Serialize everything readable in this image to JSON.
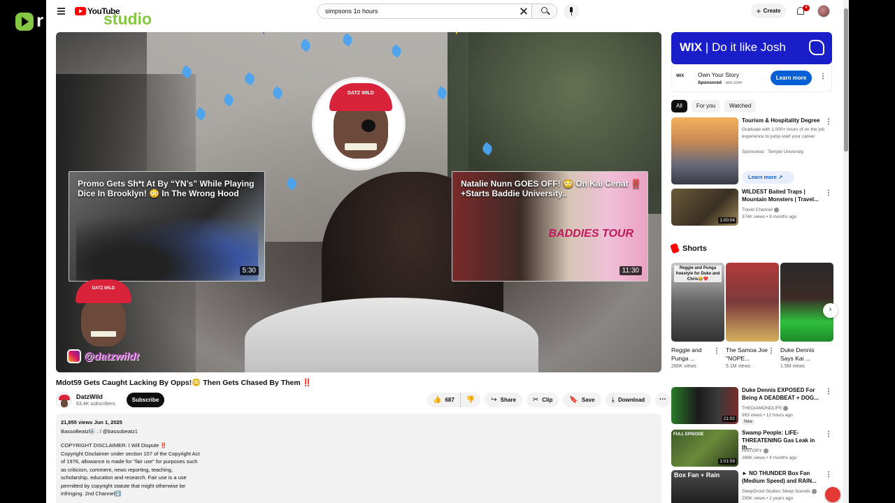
{
  "rumble": {
    "letter": "r"
  },
  "header": {
    "youtube_text": "YouTube",
    "studio_text": "studio",
    "search_value": "simpsons 1o hours",
    "create_label": "Create",
    "notification_count": "4"
  },
  "player": {
    "instagram_handle": "@datzwildt",
    "logo_cap_text": "DATZ WILD",
    "end_cards": [
      {
        "title": "Promo Gets Sh*t At By “YN’s” While Playing Dice In Brooklyn! 😳 In The Wrong Hood",
        "duration": "5:30"
      },
      {
        "title": "Natalie Nunn GOES OFF! 😳 On Kai Cenat ‼️ +Starts Baddie University..",
        "duration": "11:30",
        "overlay_text": "BADDIES TOUR"
      }
    ]
  },
  "video": {
    "title": "Mdot59 Gets Caught Lacking By Opps!😳 Then Gets Chased By Them ‼️",
    "channel_name": "DatzWild",
    "subscribers": "63.4K subscribers",
    "subscribe_label": "Subscribe",
    "likes": "687",
    "share_label": "Share",
    "clip_label": "Clip",
    "save_label": "Save",
    "download_label": "Download"
  },
  "description": {
    "views_date": "21,855 views  Jun 1, 2025",
    "credit": "BassoBeatz🎼 :  / @bassobeatz1",
    "lines": [
      "COPYRIGHT DISCLAIMER: I Will Dispute ‼️",
      "Copyright Disclaimer under section 107 of the Copyright Act",
      "of 1976, allowance is made for \"fair use\" for purposes such",
      "as criticism, comment, news reporting, teaching,",
      "scholarship, education and research. Fair use is a use",
      "permitted by copyright statute that might otherwise be",
      "infringing. 2nd Channel⬇️"
    ]
  },
  "ad": {
    "banner_text": "Do it like Josh",
    "banner_brand": "WIX",
    "mini_brand": "WiX",
    "name": "Own Your Story",
    "sponsored": "Sponsored",
    "domain": "wix.com",
    "learn_more": "Learn more"
  },
  "chips": [
    "All",
    "For you",
    "Watched"
  ],
  "recommendations": [
    {
      "title": "Tourism & Hospitality Degree",
      "desc": "Graduate with 1,000+ hours of on the job experience to jump-start your career",
      "meta": "Sponsored · Temple University",
      "learn_more": "Learn more"
    },
    {
      "title": "WILDEST Baited Traps | Mountain Monsters | Travel...",
      "channel": "Travel Channel",
      "stats": "374K views • 9 months ago",
      "duration": "1:00:04"
    }
  ],
  "shorts": {
    "heading": "Shorts",
    "items": [
      {
        "title": "Reggie and Punga ...",
        "views": "280K views",
        "overlay": "Reggie and Punga freestyle for Duke and Chris😂❤️"
      },
      {
        "title": "The Samoa Joe \"NOPE...",
        "views": "5.1M views"
      },
      {
        "title": "Duke Dennis Says Kai ...",
        "views": "1.5M views"
      }
    ]
  },
  "more_recommendations": [
    {
      "title": "Duke Dennis EXPOSED For Being A DEADBEAT + DOG...",
      "channel": "THEDIAMONDLIFE",
      "stats": "993 views • 12 hours ago",
      "badge": "New",
      "duration": "21:02"
    },
    {
      "title": "Swamp People: LIFE-THREATENING Gas Leak in th...",
      "channel": "HISTORY",
      "stats": "288K views • 4 months ago",
      "duration": "1:01:59",
      "thumb_text": "FULL EPISODE"
    },
    {
      "title": "► NO THUNDER Box Fan (Medium Speed) and RAIN...",
      "channel": "SleepDroid Studios Sleep Sounds",
      "stats": "295K views • 2 years ago",
      "thumb_text": "Box Fan + Rain"
    }
  ]
}
